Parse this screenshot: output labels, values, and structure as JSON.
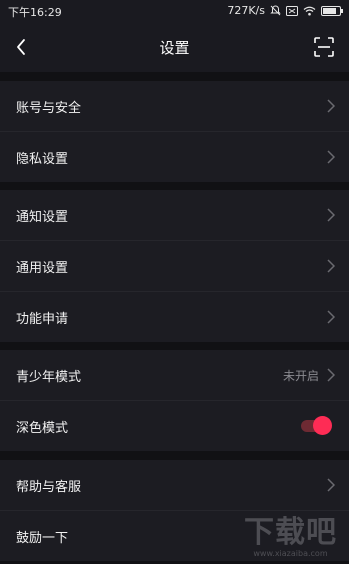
{
  "status_bar": {
    "time": "下午16:29",
    "speed": "727K/s"
  },
  "navbar": {
    "title": "设置",
    "back_icon": "chevron-left-icon",
    "scan_icon": "scan-icon"
  },
  "groups": [
    {
      "items": [
        {
          "label": "账号与安全",
          "type": "chevron"
        },
        {
          "label": "隐私设置",
          "type": "chevron"
        }
      ]
    },
    {
      "items": [
        {
          "label": "通知设置",
          "type": "chevron"
        },
        {
          "label": "通用设置",
          "type": "chevron"
        },
        {
          "label": "功能申请",
          "type": "chevron"
        }
      ]
    },
    {
      "items": [
        {
          "label": "青少年模式",
          "type": "chevron",
          "value": "未开启"
        },
        {
          "label": "深色模式",
          "type": "toggle",
          "enabled": true
        }
      ]
    },
    {
      "items": [
        {
          "label": "帮助与客服",
          "type": "chevron"
        },
        {
          "label": "鼓励一下",
          "type": "chevron"
        }
      ]
    }
  ],
  "colors": {
    "accent": "#fe2c55",
    "background": "#111114",
    "row_background": "#1c1c22",
    "secondary_text": "#8a8a90"
  },
  "watermark": {
    "text": "下载吧",
    "url": "www.xiazaiba.com"
  }
}
